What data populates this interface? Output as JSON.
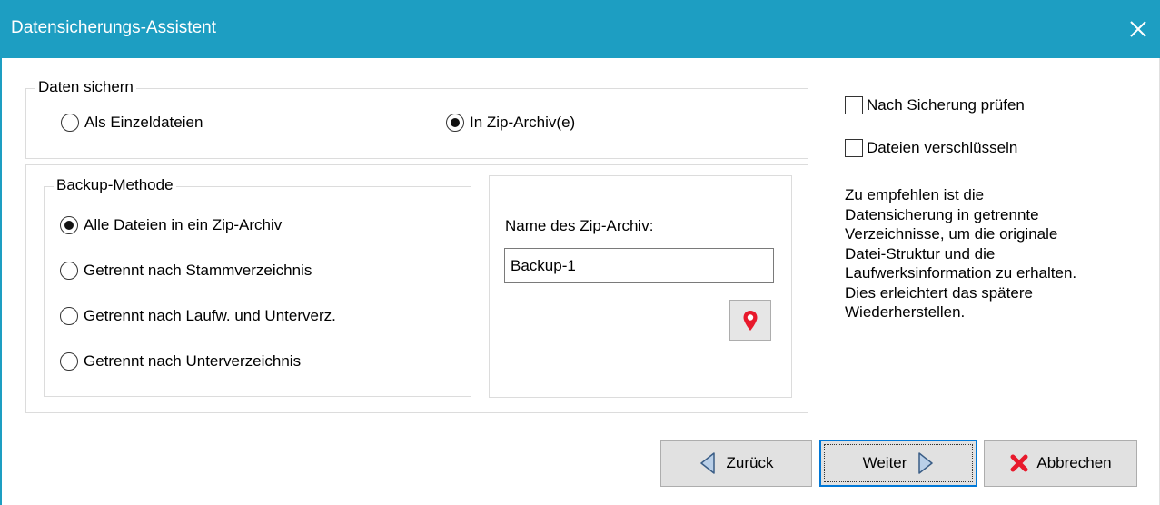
{
  "window": {
    "title": "Datensicherungs-Assistent"
  },
  "daten_sichern": {
    "legend": "Daten sichern",
    "options": [
      {
        "label": "Als Einzeldateien",
        "selected": false
      },
      {
        "label": "In Zip-Archiv(e)",
        "selected": true
      }
    ]
  },
  "backup_methode": {
    "legend": "Backup-Methode",
    "options": [
      {
        "label": "Alle Dateien in ein Zip-Archiv",
        "selected": true
      },
      {
        "label": "Getrennt nach Stammverzeichnis",
        "selected": false
      },
      {
        "label": "Getrennt nach Laufw. und Unterverz.",
        "selected": false
      },
      {
        "label": "Getrennt nach Unterverzeichnis",
        "selected": false
      }
    ]
  },
  "zip_name": {
    "label": "Name des Zip-Archiv:",
    "value": "Backup-1"
  },
  "options": {
    "verify_label": "Nach Sicherung prüfen",
    "verify_checked": false,
    "encrypt_label": "Dateien verschlüsseln",
    "encrypt_checked": false
  },
  "info": {
    "lines": [
      "Zu empfehlen ist die",
      "Datensicherung in getrennte",
      "Verzeichnisse, um die originale",
      "Datei-Struktur und die",
      "Laufwerksinformation zu erhalten.",
      "Dies erleichtert das spätere",
      "Wiederherstellen."
    ]
  },
  "buttons": {
    "back": "Zurück",
    "next": "Weiter",
    "cancel": "Abbrechen"
  },
  "colors": {
    "titlebar": "#1d9ec2",
    "location_pin": "#e8192c",
    "cancel_x": "#e8192c",
    "focus_border": "#0078d7",
    "arrow_fill": "#b9cfe8",
    "arrow_stroke": "#3a5d86"
  }
}
